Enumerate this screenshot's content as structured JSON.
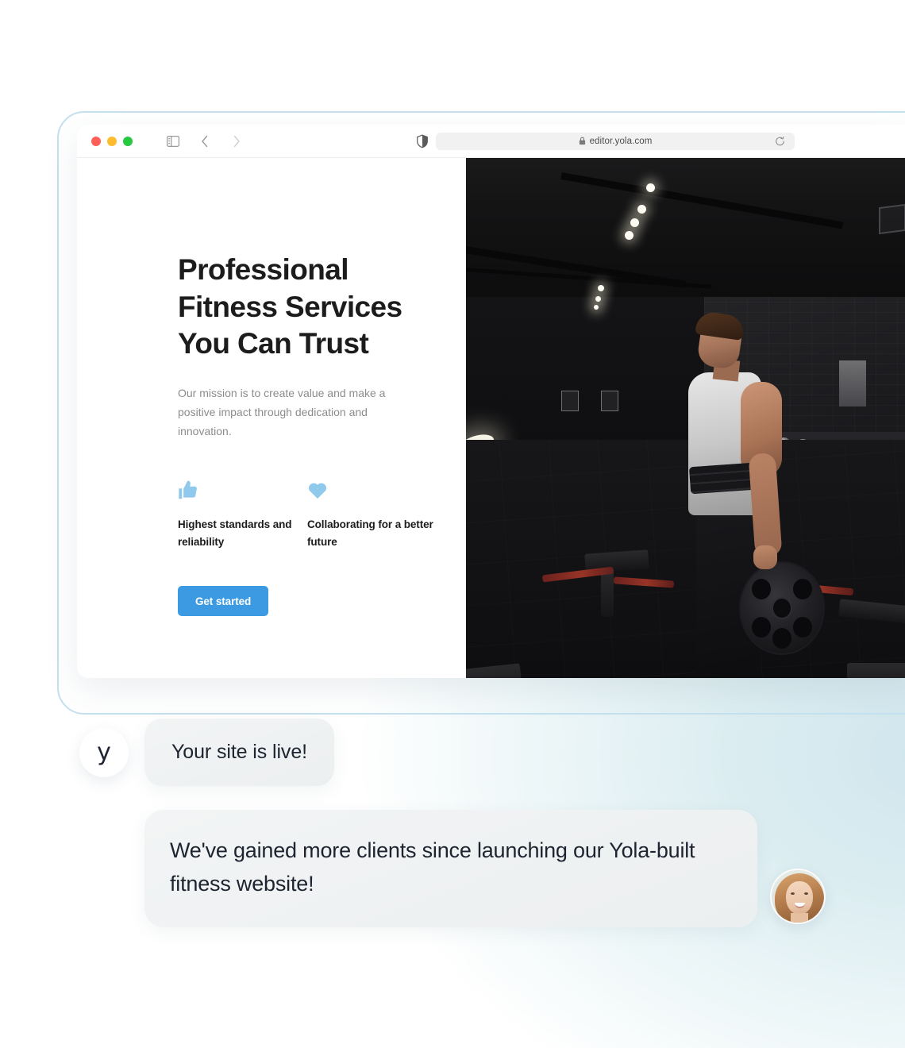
{
  "browser": {
    "url": "editor.yola.com",
    "lock_icon": "lock-icon",
    "sidebar_icon": "sidebar-toggle-icon",
    "back_icon": "chevron-left-icon",
    "forward_icon": "chevron-right-icon",
    "shield_icon": "shield-icon",
    "reload_icon": "reload-icon",
    "traffic_lights": [
      "close-red",
      "minimize-yellow",
      "maximize-green"
    ]
  },
  "site": {
    "hero_title": "Professional Fitness Services You Can Trust",
    "hero_subtitle": "Our mission is to create value and make a positive impact through dedication and innovation.",
    "features": [
      {
        "icon": "thumbs-up-icon",
        "label": "Highest standards and reliability"
      },
      {
        "icon": "heart-icon",
        "label": "Collaborating for a better future"
      }
    ],
    "cta_label": "Get started",
    "hero_image_alt": "gym-interior-athlete-holding-weight-plate"
  },
  "chat": {
    "brand_logo": "y",
    "message_1": "Your site is live!",
    "message_2": "We've gained more clients since launching our Yola-built fitness website!",
    "client_avatar_alt": "smiling-woman-portrait"
  },
  "colors": {
    "accent_blue": "#3b9ae1",
    "feature_icon_blue": "#8fc9ec",
    "frame_blue": "#c5e0ee",
    "bubble_gray": "#eff1f2",
    "text_dark": "#1d2430",
    "text_muted": "#8c8c8c"
  }
}
